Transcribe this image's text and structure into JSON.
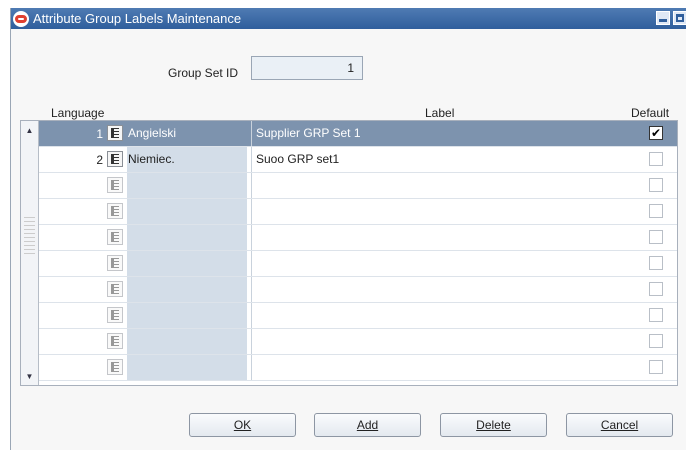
{
  "window": {
    "title": "Attribute Group Labels Maintenance"
  },
  "group_set": {
    "label": "Group Set ID",
    "value": "1"
  },
  "headers": {
    "language": "Language",
    "label": "Label",
    "default": "Default"
  },
  "rows": [
    {
      "num": "1",
      "language": "Angielski",
      "label": "Supplier GRP Set 1",
      "default": "✔"
    },
    {
      "num": "2",
      "language": "Niemiec.",
      "label": "Suoo GRP set1",
      "default": ""
    },
    {
      "num": "",
      "language": "",
      "label": "",
      "default": ""
    },
    {
      "num": "",
      "language": "",
      "label": "",
      "default": ""
    },
    {
      "num": "",
      "language": "",
      "label": "",
      "default": ""
    },
    {
      "num": "",
      "language": "",
      "label": "",
      "default": ""
    },
    {
      "num": "",
      "language": "",
      "label": "",
      "default": ""
    },
    {
      "num": "",
      "language": "",
      "label": "",
      "default": ""
    },
    {
      "num": "",
      "language": "",
      "label": "",
      "default": ""
    },
    {
      "num": "",
      "language": "",
      "label": "",
      "default": ""
    }
  ],
  "buttons": {
    "ok": "OK",
    "add": "Add",
    "delete": "Delete",
    "cancel": "Cancel"
  },
  "colors": {
    "titlebar": "#2f5e9c",
    "selected_row": "#7d93ae",
    "lang_cell": "#d3dde8"
  }
}
